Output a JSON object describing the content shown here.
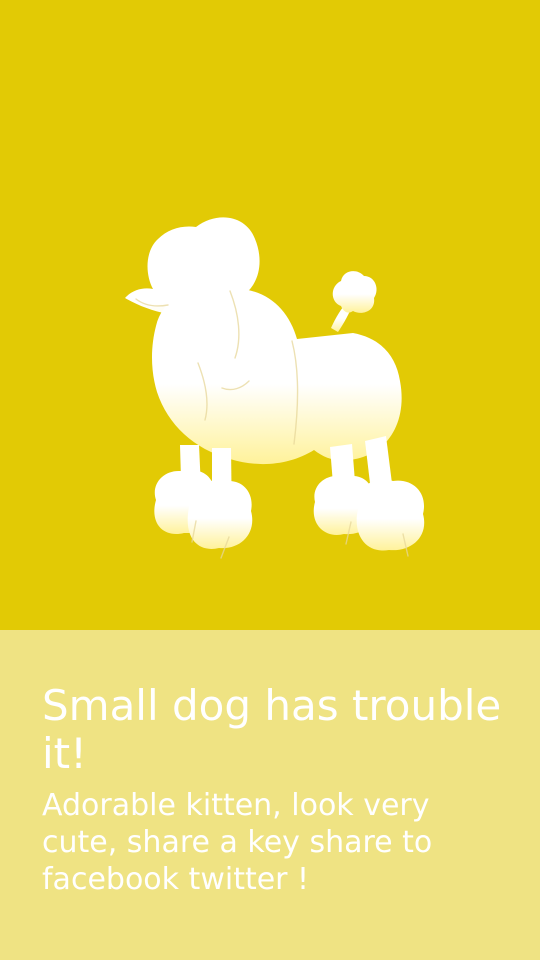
{
  "colors": {
    "hero_background": "#e2ca05",
    "caption_background": "#efe383",
    "text": "#ffffff",
    "poodle_top": "#ffffff",
    "poodle_bottom": "#fff29a"
  },
  "hero": {
    "image_icon": "poodle-silhouette-icon"
  },
  "caption": {
    "title": "Small dog has trouble it!",
    "body": "Adorable kitten, look very cute, share a key share to facebook twitter !"
  }
}
